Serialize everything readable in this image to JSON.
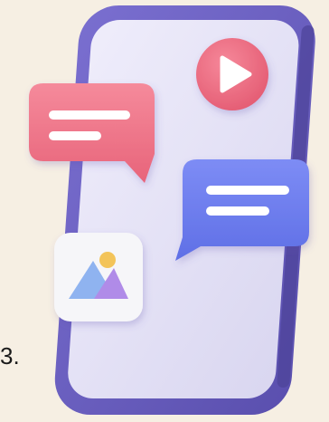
{
  "illustration": {
    "subject": "3d-smartphone-chat-illustration",
    "colors": {
      "background": "#f6efe3",
      "phone_frame": "#6e63c4",
      "phone_screen": "#e4e2f6",
      "play_button": "#ef6f83",
      "pink_bubble": "#f07a8c",
      "blue_bubble": "#6f7ff0",
      "image_card": "#f6f6f9"
    },
    "icons": [
      "play-icon",
      "chat-bubble-icon",
      "image-icon"
    ]
  },
  "text_fragment": "3."
}
